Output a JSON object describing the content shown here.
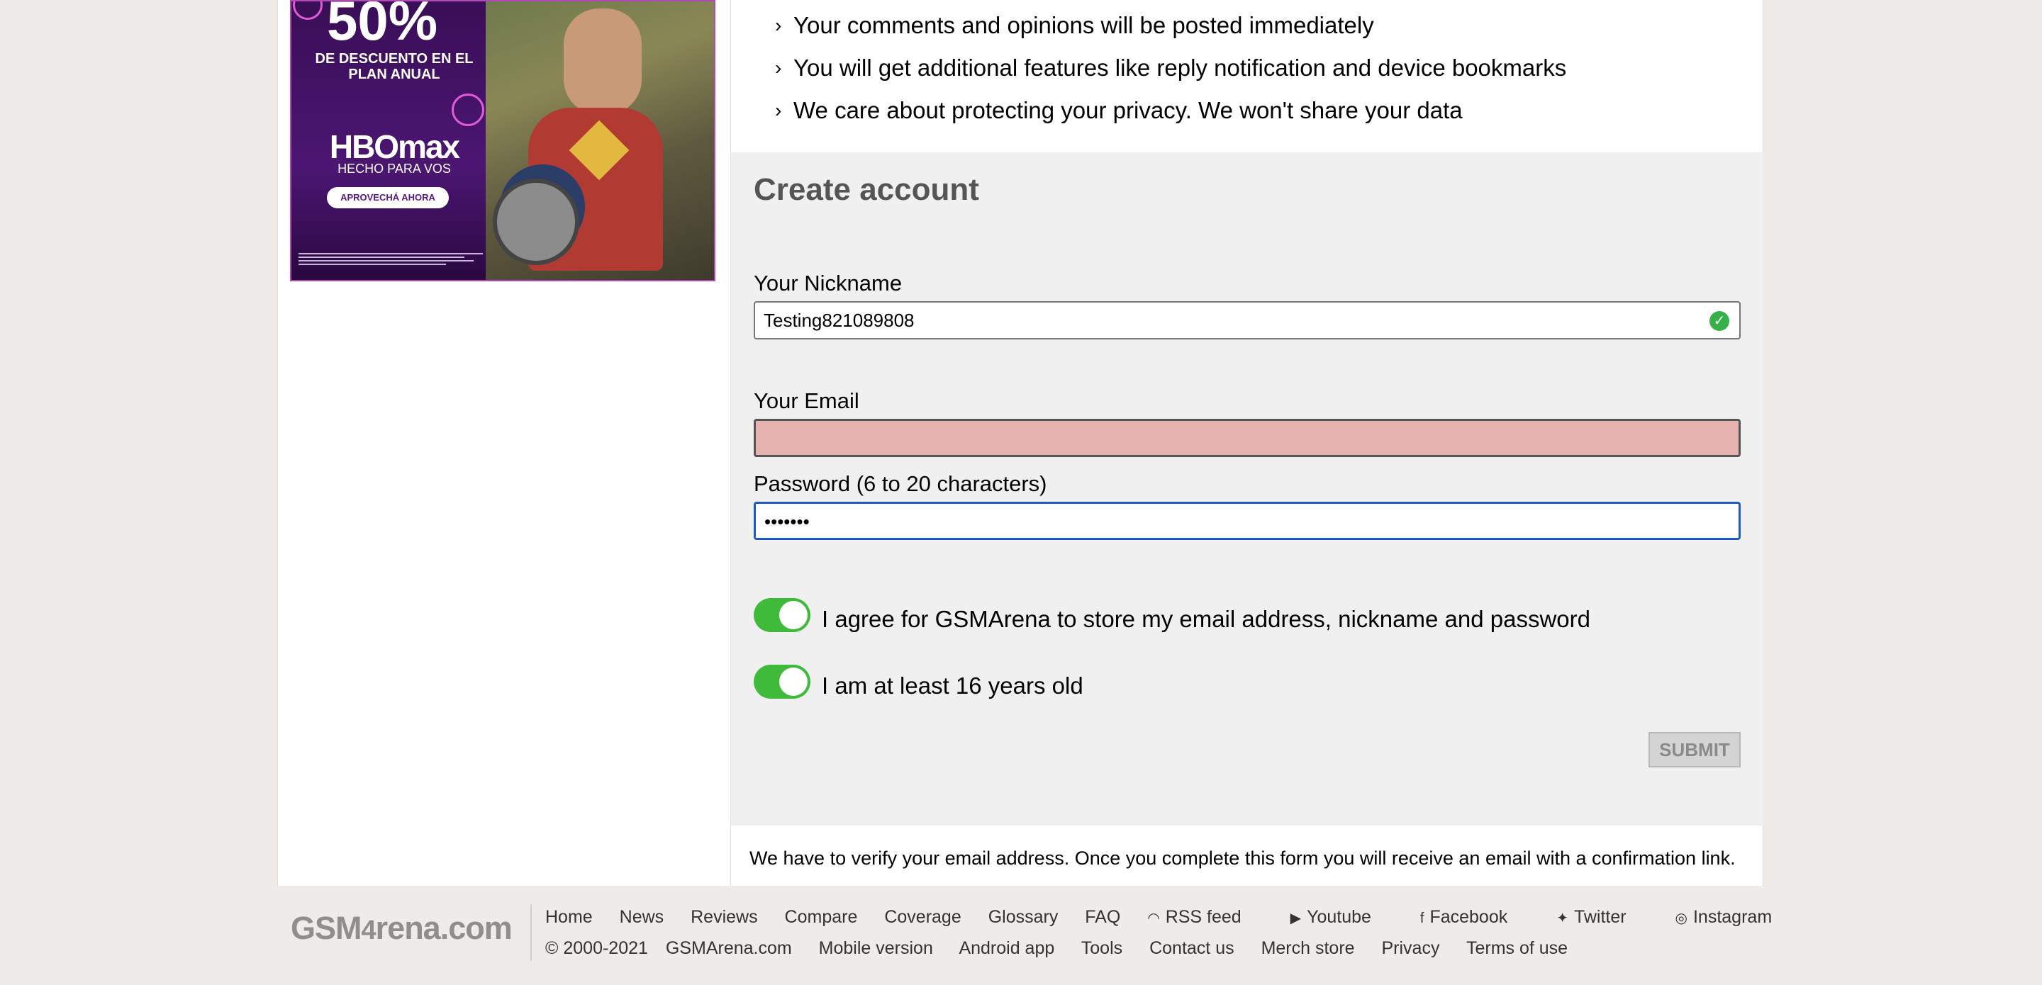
{
  "ad": {
    "big_text": "50%",
    "discount_text": "DE DESCUENTO EN EL PLAN ANUAL",
    "brand": "HBOmax",
    "brand_sub": "HECHO PARA VOS",
    "cta": "APROVECHÁ AHORA"
  },
  "benefits": [
    "Your comments and opinions will be posted immediately",
    "You will get additional features like reply notification and device bookmarks",
    "We care about protecting your privacy. We won't share your data"
  ],
  "form": {
    "title": "Create account",
    "nickname_label": "Your Nickname",
    "nickname_value": "Testing821089808",
    "email_label": "Your Email",
    "email_value": "",
    "password_label": "Password (6 to 20 characters)",
    "password_value": "•••••••",
    "agree_store_label": "I agree for GSMArena to store my email address, nickname and password",
    "agree_age_label": "I am at least 16 years old",
    "submit_label": "SUBMIT",
    "verify_notice": "We have to verify your email address. Once you complete this form you will receive an email with a confirmation link."
  },
  "footer": {
    "logo": "GSMArena.com",
    "row1": [
      "Home",
      "News",
      "Reviews",
      "Compare",
      "Coverage",
      "Glossary",
      "FAQ"
    ],
    "rss": "RSS feed",
    "youtube": "Youtube",
    "facebook": "Facebook",
    "twitter": "Twitter",
    "instagram": "Instagram",
    "copyright": "© 2000-2021",
    "row2": [
      "GSMArena.com",
      "Mobile version",
      "Android app",
      "Tools",
      "Contact us",
      "Merch store",
      "Privacy",
      "Terms of use"
    ]
  },
  "colors": {
    "toggle_on": "#3fba3a",
    "error_field": "#e6b3b1",
    "focus_border": "#1f5bc2",
    "valid_check": "#36b14a"
  }
}
